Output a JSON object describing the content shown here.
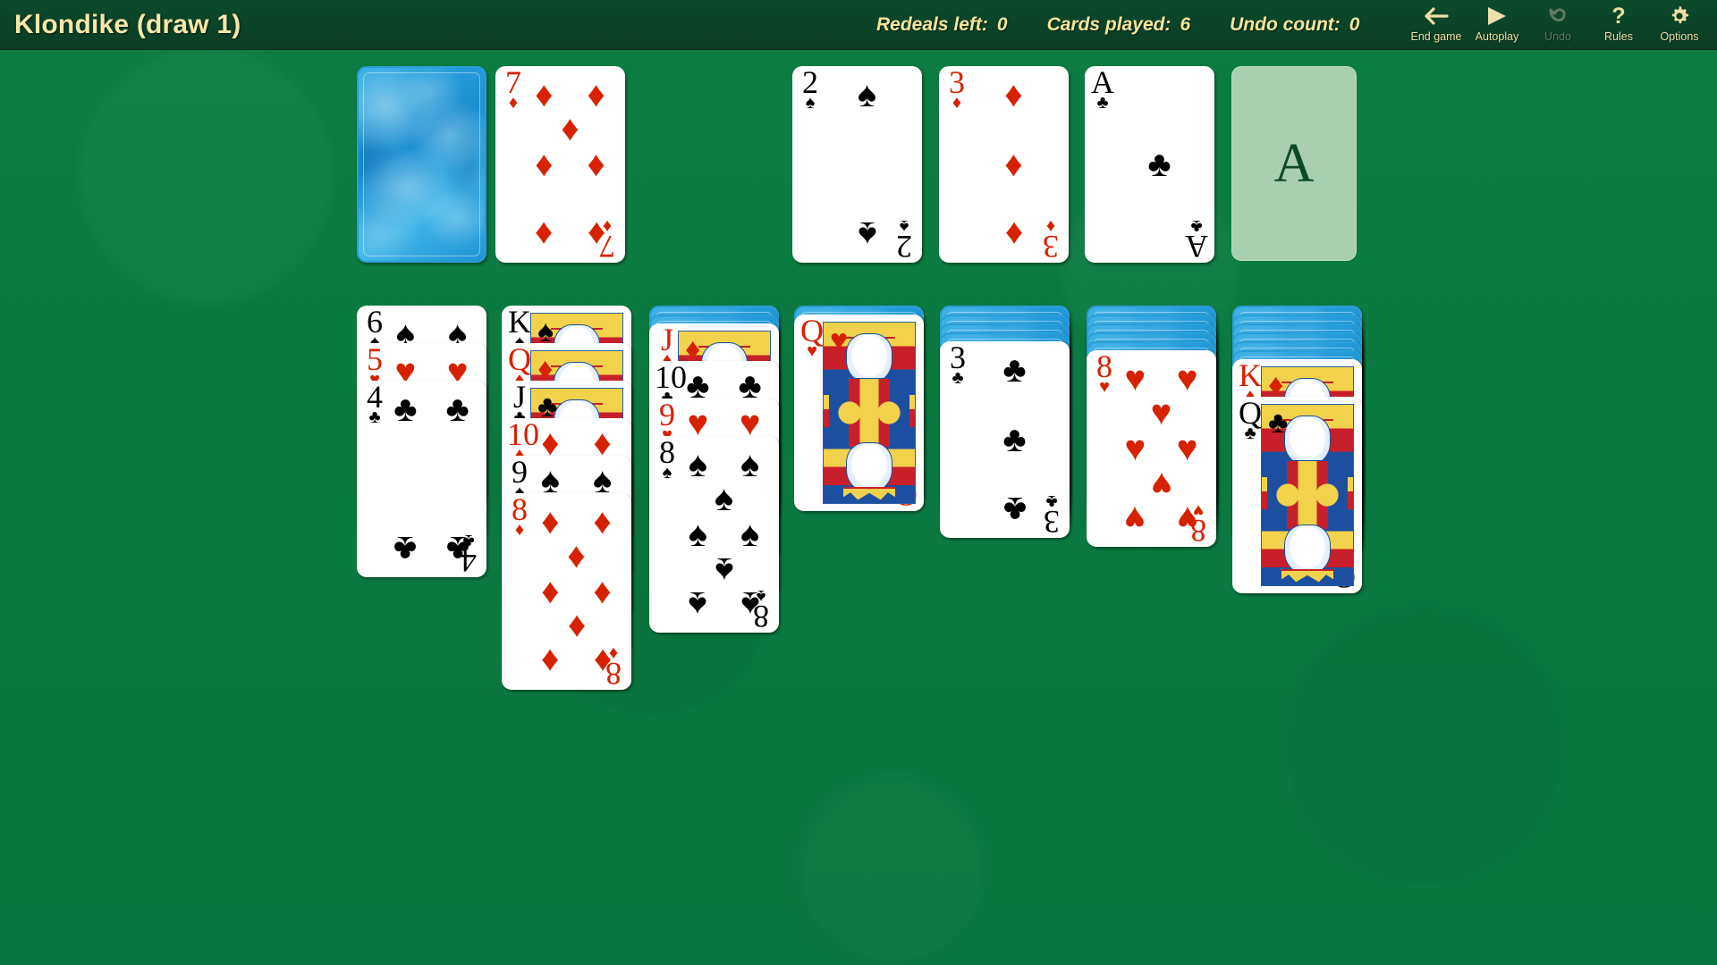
{
  "header": {
    "title": "Klondike (draw 1)",
    "stats": [
      {
        "label": "Redeals left:",
        "value": "0"
      },
      {
        "label": "Cards played:",
        "value": "6"
      },
      {
        "label": "Undo count:",
        "value": "0"
      }
    ],
    "toolbar": [
      {
        "label": "End game",
        "icon": "arrow-left-icon",
        "enabled": true
      },
      {
        "label": "Autoplay",
        "icon": "play-triangle-icon",
        "enabled": true
      },
      {
        "label": "Undo",
        "icon": "undo-arrow-icon",
        "enabled": false
      },
      {
        "label": "Rules",
        "icon": "question-mark-icon",
        "enabled": true
      },
      {
        "label": "Options",
        "icon": "gear-icon",
        "enabled": true
      }
    ]
  },
  "colors": {
    "table_green": "#0a7a40",
    "topbar_green": "#0a4228",
    "title_cream": "#f5e7a8",
    "card_back_blue": "#2aa7e0",
    "empty_slot_green": "#a8d0b0",
    "red_suit": "#d62200",
    "black_suit": "#000000"
  },
  "board": {
    "stock": {
      "name": "stock-pile",
      "face_down_count": 1,
      "empty": false
    },
    "waste": {
      "name": "waste-pile",
      "top_card": {
        "rank": "7",
        "suit": "diamonds"
      }
    },
    "foundations": [
      {
        "name": "foundation-spades",
        "top_card": {
          "rank": "2",
          "suit": "spades"
        },
        "placeholder": "A"
      },
      {
        "name": "foundation-diamonds",
        "top_card": {
          "rank": "3",
          "suit": "diamonds"
        },
        "placeholder": "A"
      },
      {
        "name": "foundation-clubs",
        "top_card": {
          "rank": "A",
          "suit": "clubs"
        },
        "placeholder": "A"
      },
      {
        "name": "foundation-hearts",
        "top_card": null,
        "placeholder": "A"
      }
    ],
    "tableau": [
      {
        "column": 1,
        "face_down": 0,
        "face_up": [
          {
            "rank": "6",
            "suit": "spades"
          },
          {
            "rank": "5",
            "suit": "hearts"
          },
          {
            "rank": "4",
            "suit": "clubs"
          }
        ]
      },
      {
        "column": 2,
        "face_down": 0,
        "face_up": [
          {
            "rank": "K",
            "suit": "spades"
          },
          {
            "rank": "Q",
            "suit": "diamonds"
          },
          {
            "rank": "J",
            "suit": "clubs"
          },
          {
            "rank": "10",
            "suit": "diamonds"
          },
          {
            "rank": "9",
            "suit": "spades"
          },
          {
            "rank": "8",
            "suit": "diamonds"
          }
        ]
      },
      {
        "column": 3,
        "face_down": 2,
        "face_up": [
          {
            "rank": "J",
            "suit": "diamonds"
          },
          {
            "rank": "10",
            "suit": "clubs"
          },
          {
            "rank": "9",
            "suit": "hearts"
          },
          {
            "rank": "8",
            "suit": "spades"
          }
        ]
      },
      {
        "column": 4,
        "face_down": 1,
        "face_up": [
          {
            "rank": "Q",
            "suit": "hearts"
          }
        ]
      },
      {
        "column": 5,
        "face_down": 4,
        "face_up": [
          {
            "rank": "3",
            "suit": "clubs"
          }
        ]
      },
      {
        "column": 6,
        "face_down": 5,
        "face_up": [
          {
            "rank": "8",
            "suit": "hearts"
          }
        ]
      },
      {
        "column": 7,
        "face_down": 6,
        "face_up": [
          {
            "rank": "K",
            "suit": "diamonds"
          },
          {
            "rank": "Q",
            "suit": "clubs"
          }
        ]
      }
    ]
  },
  "suit_glyphs": {
    "spades": "♠",
    "hearts": "♥",
    "diamonds": "♦",
    "clubs": "♣"
  }
}
